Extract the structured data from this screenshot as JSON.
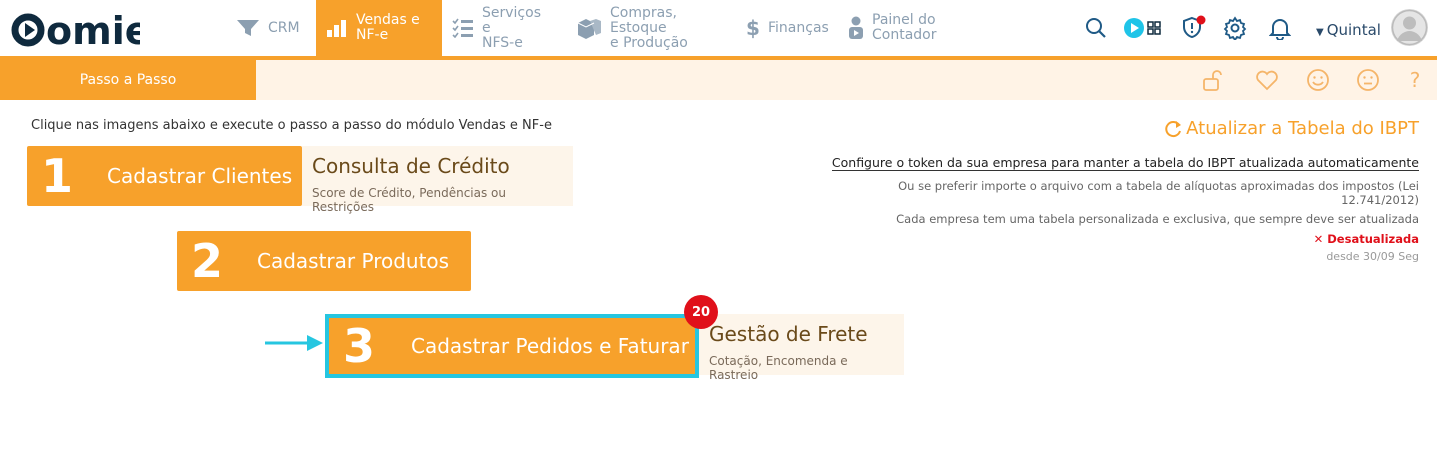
{
  "brand": {
    "logo_text": "omie"
  },
  "nav": [
    {
      "label": "CRM",
      "icon": "filter-icon"
    },
    {
      "label": "Vendas e\nNF-e",
      "icon": "bar-chart-icon",
      "active": true
    },
    {
      "label": "Serviços e\nNFS-e",
      "icon": "checklist-icon"
    },
    {
      "label": "Compras, Estoque\ne Produção",
      "icon": "boxes-icon"
    },
    {
      "label": "Finanças",
      "icon": "dollar-icon"
    },
    {
      "label": "Painel do\nContador",
      "icon": "person-icon"
    }
  ],
  "header": {
    "user_name": "Quintal"
  },
  "subbar": {
    "tab_label": "Passo a Passo"
  },
  "main": {
    "intro": "Clique nas imagens abaixo e execute o passo a passo do módulo Vendas e NF-e",
    "steps": [
      {
        "number": "1",
        "title": "Cadastrar Clientes",
        "side_title": "Consulta de Crédito",
        "side_subtitle": "Score de Crédito, Pendências ou Restrições"
      },
      {
        "number": "2",
        "title": "Cadastrar Produtos"
      },
      {
        "number": "3",
        "title": "Cadastrar Pedidos e Faturar",
        "badge": "20",
        "side_title": "Gestão de Frete",
        "side_subtitle": "Cotação, Encomenda e Rastreio"
      }
    ]
  },
  "ibpt": {
    "title": "Atualizar a Tabela do IBPT",
    "token_link": "Configure o token da sua empresa para manter a tabela do IBPT atualizada automaticamente",
    "line1": "Ou se preferir importe o arquivo com a tabela de alíquotas aproximadas dos impostos (Lei 12.741/2012)",
    "line2": "Cada empresa tem uma tabela personalizada e exclusiva, que sempre deve ser atualizada",
    "status": "✕ Desatualizada",
    "since": "desde 30/09 Seg"
  },
  "colors": {
    "accent": "#f7a12b",
    "highlight": "#26c6e0",
    "danger": "#e0101a",
    "nav_text": "#8c9fb1"
  }
}
